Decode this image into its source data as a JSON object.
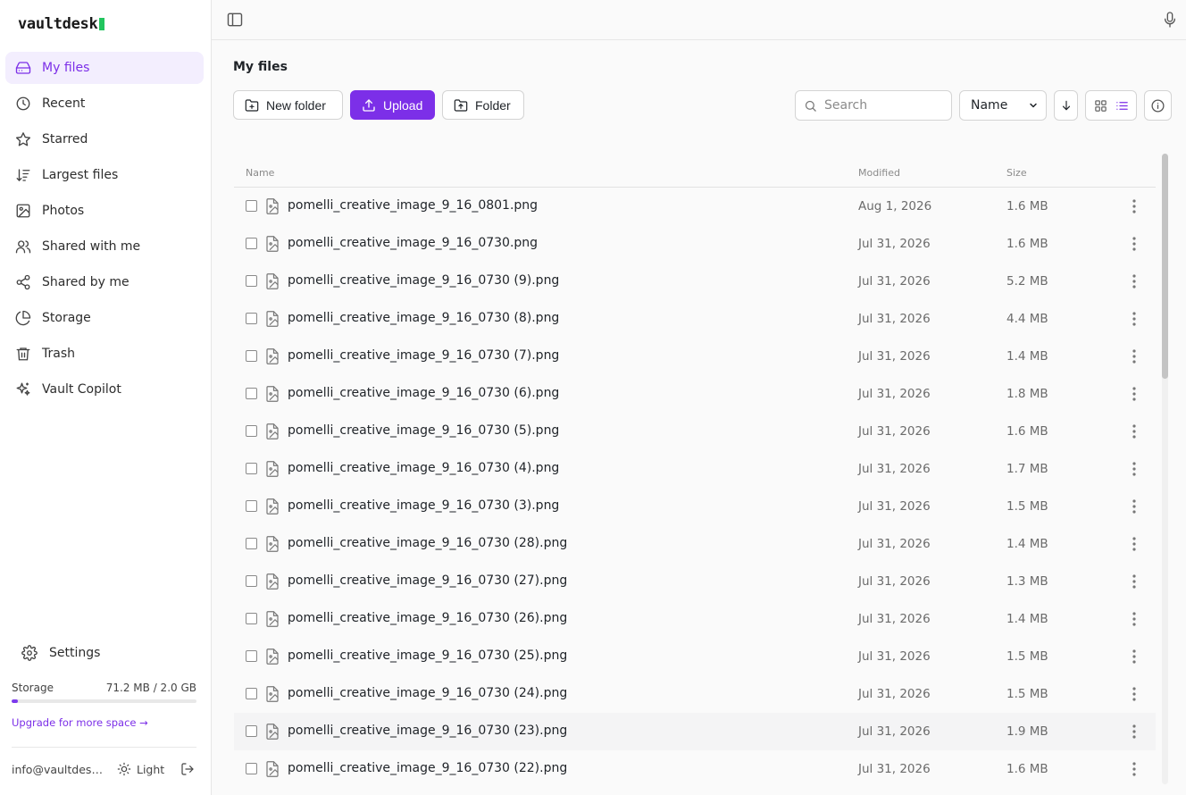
{
  "app": {
    "name": "vaultdesk"
  },
  "sidebar": {
    "items": [
      {
        "label": "My files",
        "icon": "drive-icon",
        "active": true
      },
      {
        "label": "Recent",
        "icon": "clock-icon",
        "active": false
      },
      {
        "label": "Starred",
        "icon": "star-icon",
        "active": false
      },
      {
        "label": "Largest files",
        "icon": "sort-size-icon",
        "active": false
      },
      {
        "label": "Photos",
        "icon": "image-icon",
        "active": false
      },
      {
        "label": "Shared with me",
        "icon": "users-icon",
        "active": false
      },
      {
        "label": "Shared by me",
        "icon": "share-icon",
        "active": false
      },
      {
        "label": "Storage",
        "icon": "pie-chart-icon",
        "active": false
      },
      {
        "label": "Trash",
        "icon": "trash-icon",
        "active": false
      },
      {
        "label": "Vault Copilot",
        "icon": "sparkles-icon",
        "active": false
      }
    ],
    "settings_label": "Settings",
    "storage": {
      "label": "Storage",
      "usage": "71.2 MB / 2.0 GB",
      "fraction": 0.035,
      "upgrade_label": "Upgrade for more space →"
    },
    "account": {
      "email": "info@vaultdesk.ai",
      "theme_label": "Light"
    }
  },
  "page": {
    "title": "My files"
  },
  "toolbar": {
    "new_folder_label": "New folder",
    "upload_label": "Upload",
    "folder_label": "Folder",
    "search_placeholder": "Search",
    "sort_options": [
      "Name"
    ],
    "sort_selected": "Name"
  },
  "table": {
    "columns": {
      "name": "Name",
      "modified": "Modified",
      "size": "Size"
    },
    "rows": [
      {
        "name": "pomelli_creative_image_9_16_0801.png",
        "modified": "Aug 1, 2026",
        "size": "1.6 MB"
      },
      {
        "name": "pomelli_creative_image_9_16_0730.png",
        "modified": "Jul 31, 2026",
        "size": "1.6 MB"
      },
      {
        "name": "pomelli_creative_image_9_16_0730 (9).png",
        "modified": "Jul 31, 2026",
        "size": "5.2 MB"
      },
      {
        "name": "pomelli_creative_image_9_16_0730 (8).png",
        "modified": "Jul 31, 2026",
        "size": "4.4 MB"
      },
      {
        "name": "pomelli_creative_image_9_16_0730 (7).png",
        "modified": "Jul 31, 2026",
        "size": "1.4 MB"
      },
      {
        "name": "pomelli_creative_image_9_16_0730 (6).png",
        "modified": "Jul 31, 2026",
        "size": "1.8 MB"
      },
      {
        "name": "pomelli_creative_image_9_16_0730 (5).png",
        "modified": "Jul 31, 2026",
        "size": "1.6 MB"
      },
      {
        "name": "pomelli_creative_image_9_16_0730 (4).png",
        "modified": "Jul 31, 2026",
        "size": "1.7 MB"
      },
      {
        "name": "pomelli_creative_image_9_16_0730 (3).png",
        "modified": "Jul 31, 2026",
        "size": "1.5 MB"
      },
      {
        "name": "pomelli_creative_image_9_16_0730 (28).png",
        "modified": "Jul 31, 2026",
        "size": "1.4 MB"
      },
      {
        "name": "pomelli_creative_image_9_16_0730 (27).png",
        "modified": "Jul 31, 2026",
        "size": "1.3 MB"
      },
      {
        "name": "pomelli_creative_image_9_16_0730 (26).png",
        "modified": "Jul 31, 2026",
        "size": "1.4 MB"
      },
      {
        "name": "pomelli_creative_image_9_16_0730 (25).png",
        "modified": "Jul 31, 2026",
        "size": "1.5 MB"
      },
      {
        "name": "pomelli_creative_image_9_16_0730 (24).png",
        "modified": "Jul 31, 2026",
        "size": "1.5 MB"
      },
      {
        "name": "pomelli_creative_image_9_16_0730 (23).png",
        "modified": "Jul 31, 2026",
        "size": "1.9 MB"
      },
      {
        "name": "pomelli_creative_image_9_16_0730 (22).png",
        "modified": "Jul 31, 2026",
        "size": "1.6 MB"
      }
    ]
  },
  "colors": {
    "accent": "#7c2fe8",
    "logo_mark": "#22c55e"
  }
}
